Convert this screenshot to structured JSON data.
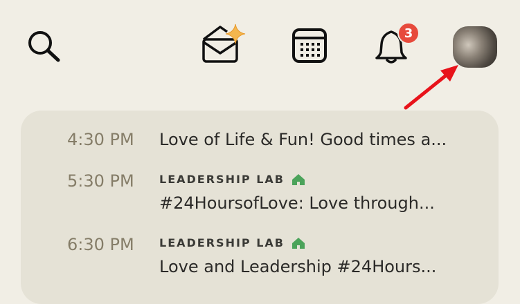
{
  "header": {
    "search_icon": "search-icon",
    "mail_icon": "envelope-sparkle-icon",
    "calendar_icon": "calendar-icon",
    "bell_icon": "bell-icon",
    "notification_count": "3",
    "badge_color": "#e74a3c",
    "avatar": "profile-avatar"
  },
  "annotation": {
    "arrow_color": "#e8131b"
  },
  "events": [
    {
      "time": "4:30 PM",
      "club": "",
      "title": "Love of Life & Fun! Good times a..."
    },
    {
      "time": "5:30 PM",
      "club": "LEADERSHIP LAB",
      "title": "#24HoursofLove: Love through..."
    },
    {
      "time": "6:30 PM",
      "club": "LEADERSHIP LAB",
      "title": "Love and Leadership #24Hours..."
    }
  ],
  "colors": {
    "background": "#f1eee5",
    "card": "#e5e2d6",
    "house_icon": "#4ba35a"
  }
}
